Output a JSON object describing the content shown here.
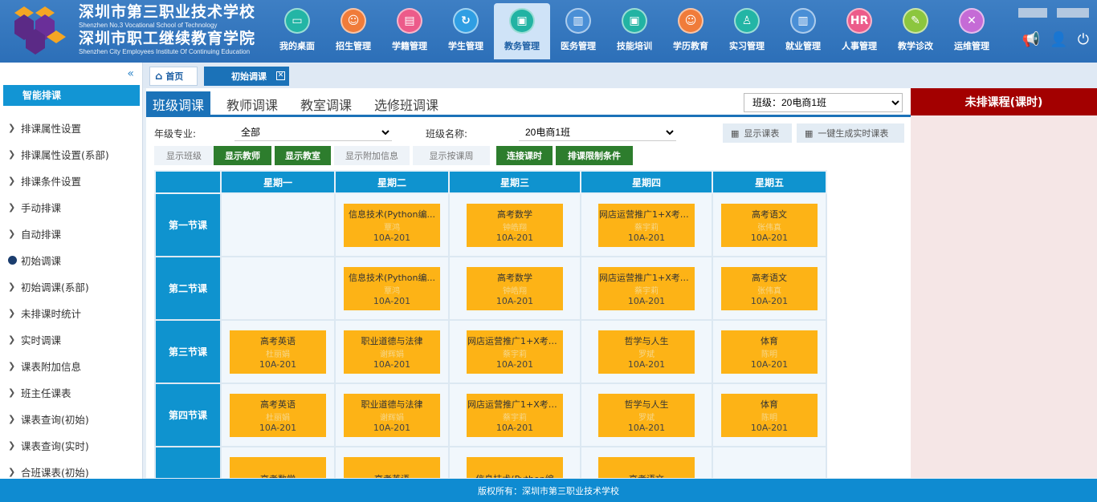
{
  "brand": {
    "name_cn_1": "深圳市第三职业技术学校",
    "name_en_1": "Shenzhen No.3 Vocational School of Technology",
    "name_cn_2": "深圳市职工继续教育学院",
    "name_en_2": "Shenzhen City Employees Institute Of Continuing Education"
  },
  "nav": [
    {
      "label": "我的桌面",
      "color": "#23b5a5",
      "glyph": "▭"
    },
    {
      "label": "招生管理",
      "color": "#f07c3a",
      "glyph": "☺"
    },
    {
      "label": "学籍管理",
      "color": "#ec5b8a",
      "glyph": "▤"
    },
    {
      "label": "学生管理",
      "color": "#2f9ee3",
      "glyph": "↻"
    },
    {
      "label": "教务管理",
      "color": "#22b3a3",
      "glyph": "▣"
    },
    {
      "label": "医务管理",
      "color": "#4a8fd6",
      "glyph": "▥"
    },
    {
      "label": "技能培训",
      "color": "#22b3a3",
      "glyph": "▣"
    },
    {
      "label": "学历教育",
      "color": "#f07c3a",
      "glyph": "☺"
    },
    {
      "label": "实习管理",
      "color": "#23b5a5",
      "glyph": "♙"
    },
    {
      "label": "就业管理",
      "color": "#4a8fd6",
      "glyph": "▥"
    },
    {
      "label": "人事管理",
      "color": "#ec5b8a",
      "glyph": "HR"
    },
    {
      "label": "教学诊改",
      "color": "#8cc63e",
      "glyph": "✎"
    },
    {
      "label": "运维管理",
      "color": "#c56bd6",
      "glyph": "✕"
    }
  ],
  "nav_active_index": 4,
  "sidebar": {
    "title": "智能排课",
    "items": [
      {
        "label": "排课属性设置"
      },
      {
        "label": "排课属性设置(系部)"
      },
      {
        "label": "排课条件设置"
      },
      {
        "label": "手动排课"
      },
      {
        "label": "自动排课"
      },
      {
        "label": "初始调课"
      },
      {
        "label": "初始调课(系部)"
      },
      {
        "label": "未排课时统计"
      },
      {
        "label": "实时调课"
      },
      {
        "label": "课表附加信息"
      },
      {
        "label": "班主任课表"
      },
      {
        "label": "课表查询(初始)"
      },
      {
        "label": "课表查询(实时)"
      },
      {
        "label": "合班课表(初始)"
      }
    ],
    "active_index": 5
  },
  "tabs": {
    "home": "首页",
    "current": "初始调课"
  },
  "subtabs": [
    "班级调课",
    "教师调课",
    "教室调课",
    "选修班调课"
  ],
  "class_select": "班级：20电商1班",
  "filters": {
    "grade_label": "年级专业:",
    "grade_value": "全部",
    "class_label": "班级名称:",
    "class_value": "20电商1班",
    "show_schedule": "显示课表",
    "gen_realtime": "一键生成实时课表"
  },
  "buttons": {
    "show_class": "显示班级",
    "show_teacher": "显示教师",
    "show_room": "显示教室",
    "show_extra": "显示附加信息",
    "show_week": "显示按课周",
    "link_hours": "连接课时",
    "limit_cond": "排课限制条件"
  },
  "schedule": {
    "days": [
      "星期一",
      "星期二",
      "星期三",
      "星期四",
      "星期五"
    ],
    "rows": [
      {
        "period": "第一节课",
        "cells": [
          null,
          {
            "course": "信息技术(Python编...",
            "teacher": "覃鸿",
            "room": "10A-201"
          },
          {
            "course": "高考数学",
            "teacher": "钟皓翔",
            "room": "10A-201"
          },
          {
            "course": "网店运营推广1+X考证实...",
            "teacher": "蔡宇莉",
            "room": "10A-201"
          },
          {
            "course": "高考语文",
            "teacher": "张伟真",
            "room": "10A-201"
          }
        ]
      },
      {
        "period": "第二节课",
        "cells": [
          null,
          {
            "course": "信息技术(Python编...",
            "teacher": "覃鸿",
            "room": "10A-201"
          },
          {
            "course": "高考数学",
            "teacher": "钟皓翔",
            "room": "10A-201"
          },
          {
            "course": "网店运营推广1+X考证实...",
            "teacher": "蔡宇莉",
            "room": "10A-201"
          },
          {
            "course": "高考语文",
            "teacher": "张伟真",
            "room": "10A-201"
          }
        ]
      },
      {
        "period": "第三节课",
        "cells": [
          {
            "course": "高考英语",
            "teacher": "杜丽娟",
            "room": "10A-201"
          },
          {
            "course": "职业道德与法律",
            "teacher": "谢辉娟",
            "room": "10A-201"
          },
          {
            "course": "网店运营推广1+X考证实...",
            "teacher": "蔡宇莉",
            "room": "10A-201"
          },
          {
            "course": "哲学与人生",
            "teacher": "罗斌",
            "room": "10A-201"
          },
          {
            "course": "体育",
            "teacher": "陈明",
            "room": "10A-201"
          }
        ]
      },
      {
        "period": "第四节课",
        "cells": [
          {
            "course": "高考英语",
            "teacher": "杜丽娟",
            "room": "10A-201"
          },
          {
            "course": "职业道德与法律",
            "teacher": "谢辉娟",
            "room": "10A-201"
          },
          {
            "course": "网店运营推广1+X考证实...",
            "teacher": "蔡宇莉",
            "room": "10A-201"
          },
          {
            "course": "哲学与人生",
            "teacher": "罗斌",
            "room": "10A-201"
          },
          {
            "course": "体育",
            "teacher": "陈明",
            "room": "10A-201"
          }
        ]
      },
      {
        "period": "",
        "cells": [
          {
            "course": "高考数学",
            "teacher": "",
            "room": ""
          },
          {
            "course": "高考英语",
            "teacher": "",
            "room": ""
          },
          {
            "course": "信息技术(Python编",
            "teacher": "",
            "room": ""
          },
          {
            "course": "高考语文",
            "teacher": "",
            "room": ""
          },
          null
        ]
      }
    ]
  },
  "right_panel": {
    "title": "未排课程(课时)"
  },
  "footer": "版权所有：深圳市第三职业技术学校",
  "colors": {
    "header": "#2c6fb8",
    "accent": "#0f93cf",
    "card": "#fdb316",
    "green": "#2d7d2d",
    "alert": "#a30000"
  }
}
